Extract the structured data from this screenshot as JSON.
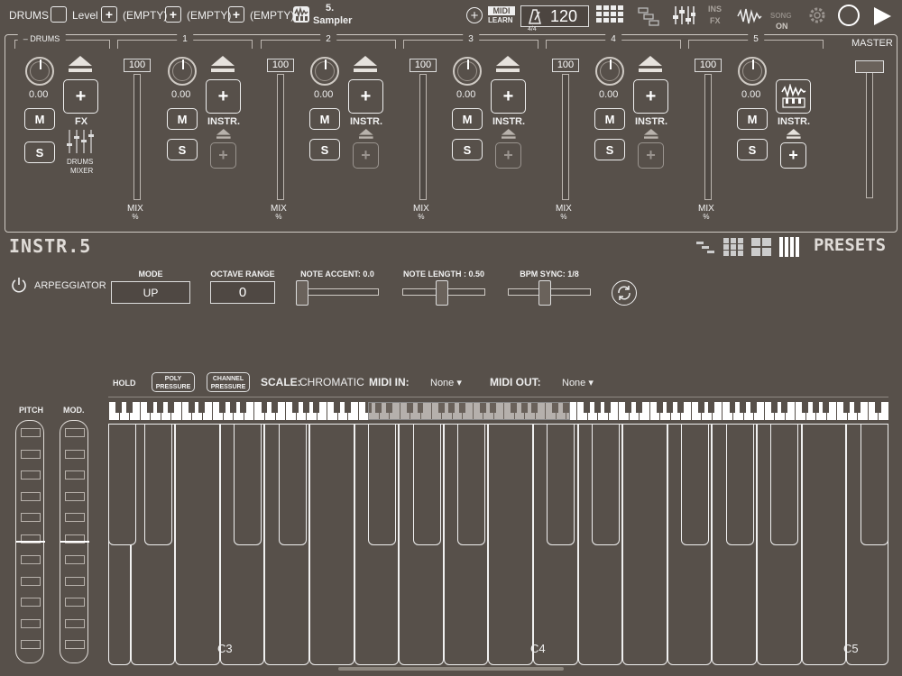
{
  "top_bar": {
    "drums_label": "DRUMS",
    "level_label": "Level",
    "slots": [
      "(EMPTY)",
      "(EMPTY)",
      "(EMPTY)"
    ],
    "instrument_number": "5.",
    "instrument_name": "Sampler",
    "midi_label": "MIDI",
    "learn_label": "LEARN",
    "time_signature": "4/4",
    "tempo": "120",
    "ins_fx_top": "INS",
    "ins_fx_bottom": "FX",
    "song_label": "SONG",
    "song_state": "ON"
  },
  "mixer": {
    "drums_header": "DRUMS",
    "drums_knob_value": "0.00",
    "fx_label": "FX",
    "mute_label": "M",
    "solo_label": "S",
    "drums_mixer_label_1": "DRUMS",
    "drums_mixer_label_2": "MIXER",
    "master_label": "MASTER",
    "mix_label": "MIX",
    "mix_unit": "%",
    "instr_label": "INSTR.",
    "channels": [
      {
        "num": "1",
        "level": "100",
        "knob": "0.00"
      },
      {
        "num": "2",
        "level": "100",
        "knob": "0.00"
      },
      {
        "num": "3",
        "level": "100",
        "knob": "0.00"
      },
      {
        "num": "4",
        "level": "100",
        "knob": "0.00"
      },
      {
        "num": "5",
        "level": "100",
        "knob": "0.00"
      }
    ]
  },
  "instrument_panel": {
    "title": "INSTR.5",
    "presets_label": "PRESETS"
  },
  "arpeggiator": {
    "label": "ARPEGGIATOR",
    "mode_title": "MODE",
    "mode_value": "UP",
    "octave_title": "OCTAVE RANGE",
    "octave_value": "0",
    "accent_title": "NOTE ACCENT: 0.0",
    "accent_value": 0.0,
    "length_title": "NOTE LENGTH : 0.50",
    "length_value": 0.5,
    "bpm_title": "BPM SYNC: 1/8"
  },
  "keyboard_bar": {
    "hold_label": "HOLD",
    "poly_label_1": "POLY",
    "poly_label_2": "PRESSURE",
    "channel_label_1": "CHANNEL",
    "channel_label_2": "PRESSURE",
    "scale_label": "SCALE:",
    "scale_value": "CHROMATIC",
    "midi_in_label": "MIDI IN:",
    "midi_in_value": "None ▾",
    "midi_out_label": "MIDI OUT:",
    "midi_out_value": "None ▾"
  },
  "wheels": {
    "pitch_label": "PITCH",
    "mod_label": "MOD."
  },
  "keyboard": {
    "key_labels": [
      "C3",
      "C4",
      "C5"
    ]
  },
  "colors": {
    "background": "#57504a",
    "foreground": "#f2f2f2",
    "dim": "#9a948f"
  }
}
